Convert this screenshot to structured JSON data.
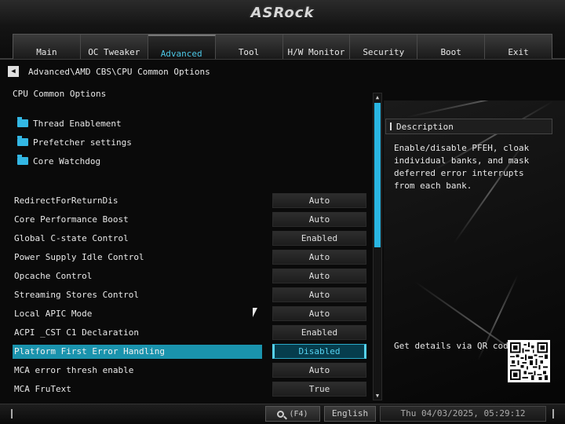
{
  "header": {
    "logo_text": "ASRock",
    "tabs": [
      {
        "label": "Main"
      },
      {
        "label": "OC Tweaker"
      },
      {
        "label": "Advanced",
        "active": true
      },
      {
        "label": "Tool"
      },
      {
        "label": "H/W Monitor"
      },
      {
        "label": "Security"
      },
      {
        "label": "Boot"
      },
      {
        "label": "Exit"
      }
    ]
  },
  "breadcrumb": {
    "back_icon": "left-triangle-icon",
    "path": "Advanced\\AMD CBS\\CPU Common Options"
  },
  "section_title": "CPU Common Options",
  "submenus": [
    {
      "label": "Thread Enablement",
      "icon": "folder-icon"
    },
    {
      "label": "Prefetcher settings",
      "icon": "folder-icon"
    },
    {
      "label": "Core Watchdog",
      "icon": "folder-icon"
    }
  ],
  "options": [
    {
      "label": "RedirectForReturnDis",
      "value": "Auto"
    },
    {
      "label": "Core Performance Boost",
      "value": "Auto"
    },
    {
      "label": "Global C-state Control",
      "value": "Enabled"
    },
    {
      "label": "Power Supply Idle Control",
      "value": "Auto"
    },
    {
      "label": "Opcache Control",
      "value": "Auto"
    },
    {
      "label": "Streaming Stores Control",
      "value": "Auto"
    },
    {
      "label": "Local APIC Mode",
      "value": "Auto"
    },
    {
      "label": "ACPI _CST C1 Declaration",
      "value": "Enabled"
    },
    {
      "label": "Platform First Error Handling",
      "value": "Disabled",
      "selected": true
    },
    {
      "label": "MCA error thresh enable",
      "value": "Auto"
    },
    {
      "label": "MCA FruText",
      "value": "True"
    }
  ],
  "description": {
    "title": "Description",
    "text": "Enable/disable PFEH, cloak individual banks, and mask deferred error interrupts from each bank.",
    "qr_label": "Get details via QR code"
  },
  "footer": {
    "search_label": "(F4)",
    "language": "English",
    "datetime": "Thu 04/03/2025, 05:29:12"
  },
  "colors": {
    "accent": "#29b5e2",
    "selected_bg": "#1a93ad"
  }
}
